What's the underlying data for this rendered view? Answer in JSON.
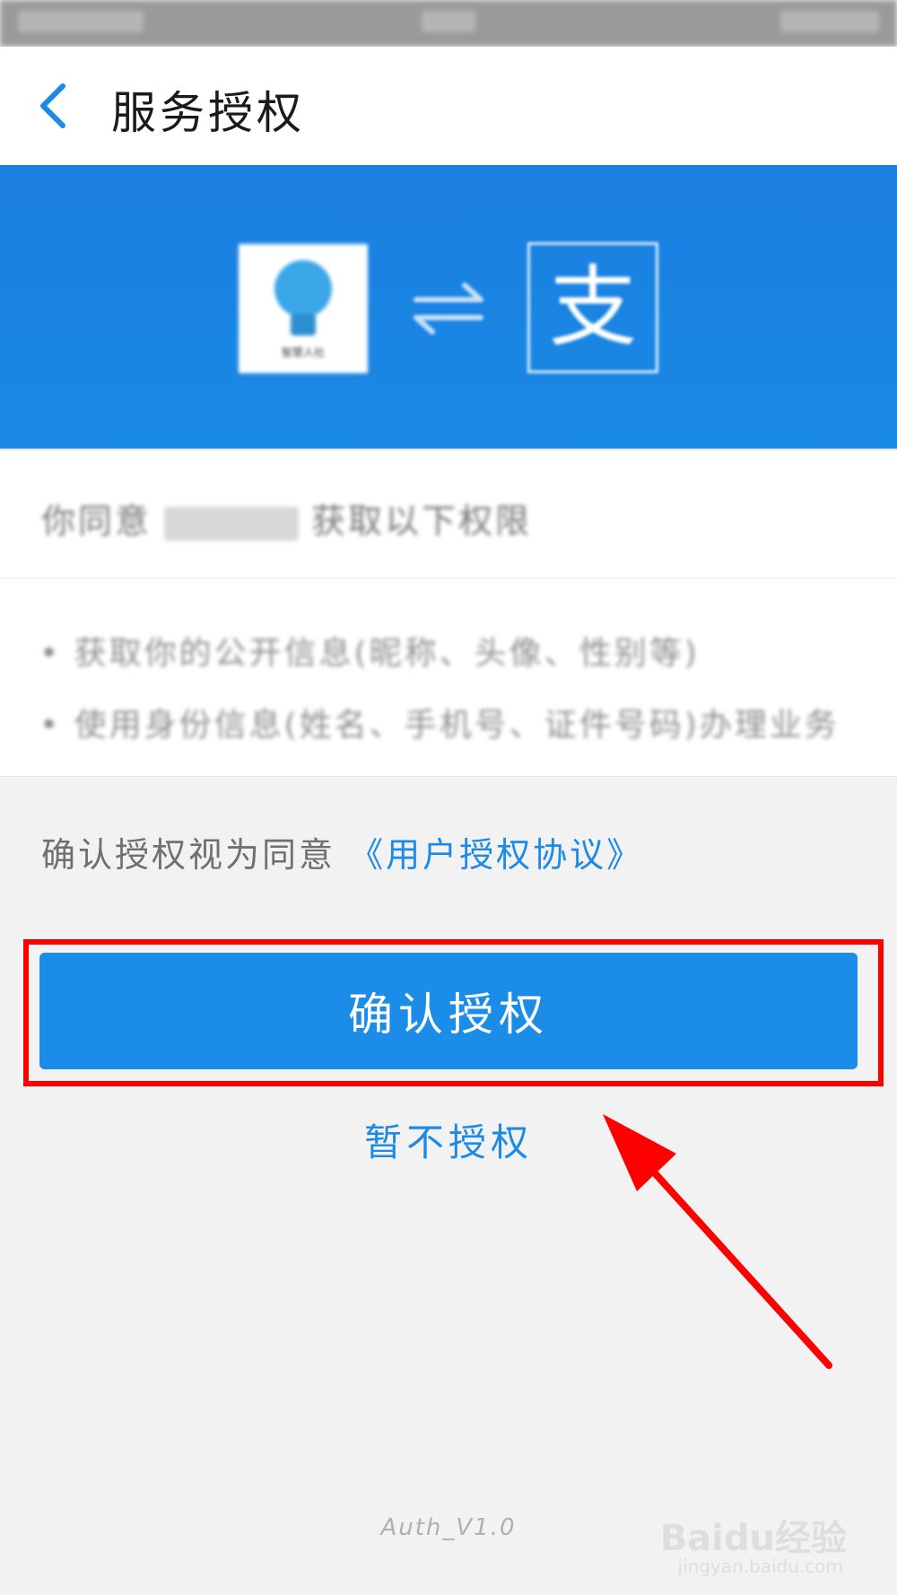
{
  "header": {
    "title": "服务授权",
    "back_icon": "chevron-left-icon"
  },
  "banner": {
    "app_logo_label": "智慧人社",
    "exchange_icon": "exchange-arrows-icon",
    "alipay_logo_char": "支"
  },
  "consent": {
    "title_prefix": "你同意",
    "title_suffix": "获取以下权限",
    "permissions": [
      "• 获取你的公开信息(昵称、头像、性别等)",
      "• 使用身份信息(姓名、手机号、证件号码)办理业务"
    ]
  },
  "agreement": {
    "text": "确认授权视为同意",
    "link": "《用户授权协议》"
  },
  "buttons": {
    "confirm_label": "确认授权",
    "decline_label": "暂不授权"
  },
  "footer": {
    "version": "Auth_V1.0",
    "watermark_main": "Baidu经验",
    "watermark_sub": "jingyan.baidu.com"
  },
  "colors": {
    "primary_blue": "#1b8de8",
    "highlight_red": "#ff0000"
  }
}
